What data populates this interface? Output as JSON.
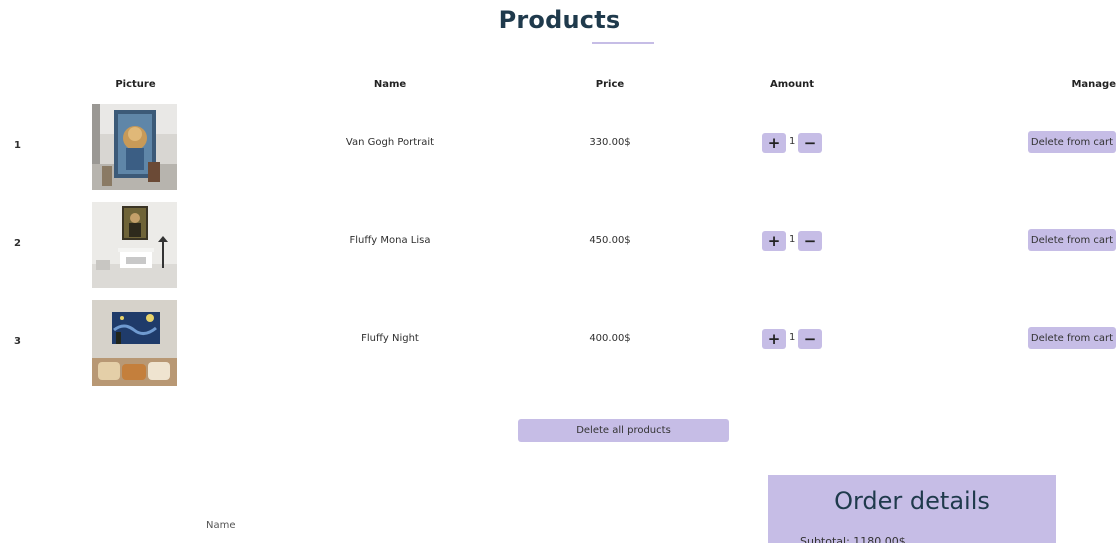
{
  "page": {
    "title": "Products"
  },
  "table": {
    "headers": {
      "picture": "Picture",
      "name": "Name",
      "price": "Price",
      "amount": "Amount",
      "manage": "Manage"
    },
    "rows": [
      {
        "index": "1",
        "name": "Van Gogh Portrait",
        "price": "330.00$",
        "amount": "1",
        "plus_label": "+",
        "minus_label": "−",
        "delete_label": "Delete from cart"
      },
      {
        "index": "2",
        "name": "Fluffy Mona Lisa",
        "price": "450.00$",
        "amount": "1",
        "plus_label": "+",
        "minus_label": "−",
        "delete_label": "Delete from cart"
      },
      {
        "index": "3",
        "name": "Fluffy Night",
        "price": "400.00$",
        "amount": "1",
        "plus_label": "+",
        "minus_label": "−",
        "delete_label": "Delete from cart"
      }
    ]
  },
  "actions": {
    "delete_all_label": "Delete all products"
  },
  "form": {
    "name_label": "Name"
  },
  "order": {
    "title": "Order details",
    "subtotal": "Subtotal: 1180.00$"
  },
  "colors": {
    "accent": "#c6bde6",
    "title": "#1f3a4c"
  }
}
